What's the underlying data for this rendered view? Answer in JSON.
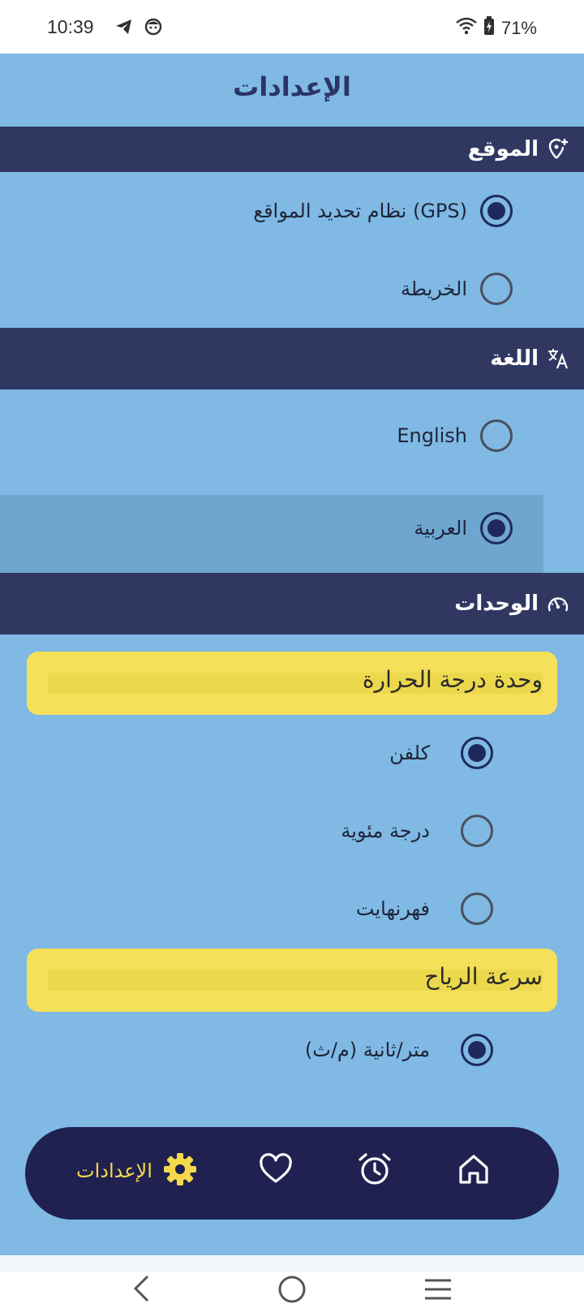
{
  "status_bar": {
    "time": "10:39",
    "battery": "71%"
  },
  "header": {
    "title": "الإعدادات"
  },
  "location": {
    "title": "الموقع",
    "options": [
      {
        "label": "نظام تحديد المواقع (GPS)",
        "selected": true
      },
      {
        "label": "الخريطة",
        "selected": false
      }
    ]
  },
  "language": {
    "title": "اللغة",
    "options": [
      {
        "label": "English",
        "selected": false
      },
      {
        "label": "العربية",
        "selected": true
      }
    ]
  },
  "units": {
    "title": "الوحدات",
    "temperature": {
      "title": "وحدة درجة الحرارة",
      "options": [
        {
          "label": "كلفن",
          "selected": true
        },
        {
          "label": "درجة مئوية",
          "selected": false
        },
        {
          "label": "فهرنهايت",
          "selected": false
        }
      ]
    },
    "wind": {
      "title": "سرعة الرياح",
      "options": [
        {
          "label": "متر/ثانية (م/ث)",
          "selected": true
        }
      ]
    }
  },
  "bottom_nav": {
    "items": [
      {
        "icon": "home-icon"
      },
      {
        "icon": "alarm-icon"
      },
      {
        "icon": "heart-icon"
      },
      {
        "icon": "gear-icon",
        "label": "الإعدادات",
        "active": true
      }
    ]
  },
  "colors": {
    "background": "#7fb9e4",
    "section_header": "#303862",
    "subheader": "#f5e05a",
    "nav_bg": "#202150",
    "nav_active": "#f5d94a"
  }
}
